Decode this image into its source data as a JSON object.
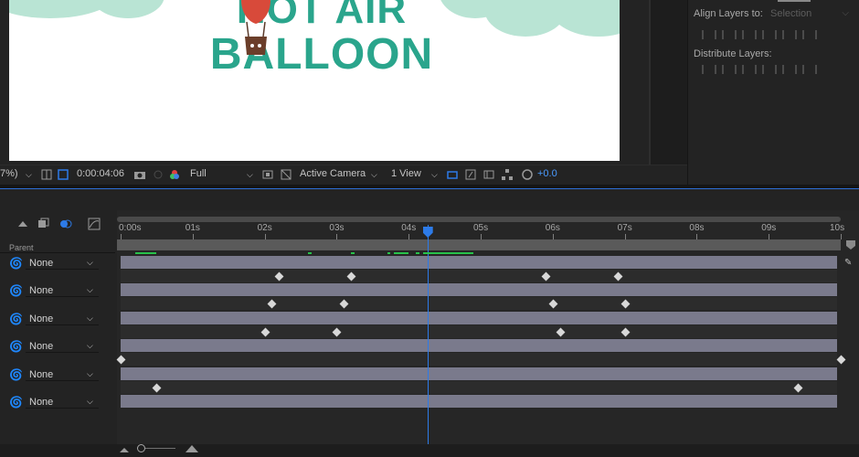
{
  "composition": {
    "title_line1": "HOT AIR",
    "title_line2": "BALLOON",
    "colors": {
      "title": "#2aa58c",
      "cloud": "#b9e4d4",
      "background": "#ffffff"
    }
  },
  "align_panel": {
    "align_label": "Align Layers to:",
    "align_target": "Selection",
    "distribute_label": "Distribute Layers:"
  },
  "viewer_toolbar": {
    "zoom": "7%)",
    "timecode": "0:00:04:06",
    "resolution": "Full",
    "camera": "Active Camera",
    "views": "1 View",
    "exposure": "+0.0"
  },
  "timeline": {
    "ruler_labels": [
      "0:00s",
      "01s",
      "02s",
      "03s",
      "04s",
      "05s",
      "06s",
      "07s",
      "08s",
      "09s",
      "10s"
    ],
    "parent_header": "Parent",
    "parent_rows": [
      {
        "value": "None"
      },
      {
        "value": "None"
      },
      {
        "value": "None"
      },
      {
        "value": "None"
      },
      {
        "value": "None"
      },
      {
        "value": "None"
      }
    ],
    "current_time_seconds": 4.26,
    "duration_seconds": 10,
    "keyframes_seconds": [
      [
        2.2,
        3.2,
        5.9,
        6.9
      ],
      [
        2.1,
        3.1,
        6.0,
        7.0
      ],
      [
        2.0,
        3.0,
        6.1,
        7.0
      ],
      [
        0.0,
        10.0
      ],
      [
        0.5,
        9.4
      ]
    ],
    "accent": "#2d7be8"
  }
}
